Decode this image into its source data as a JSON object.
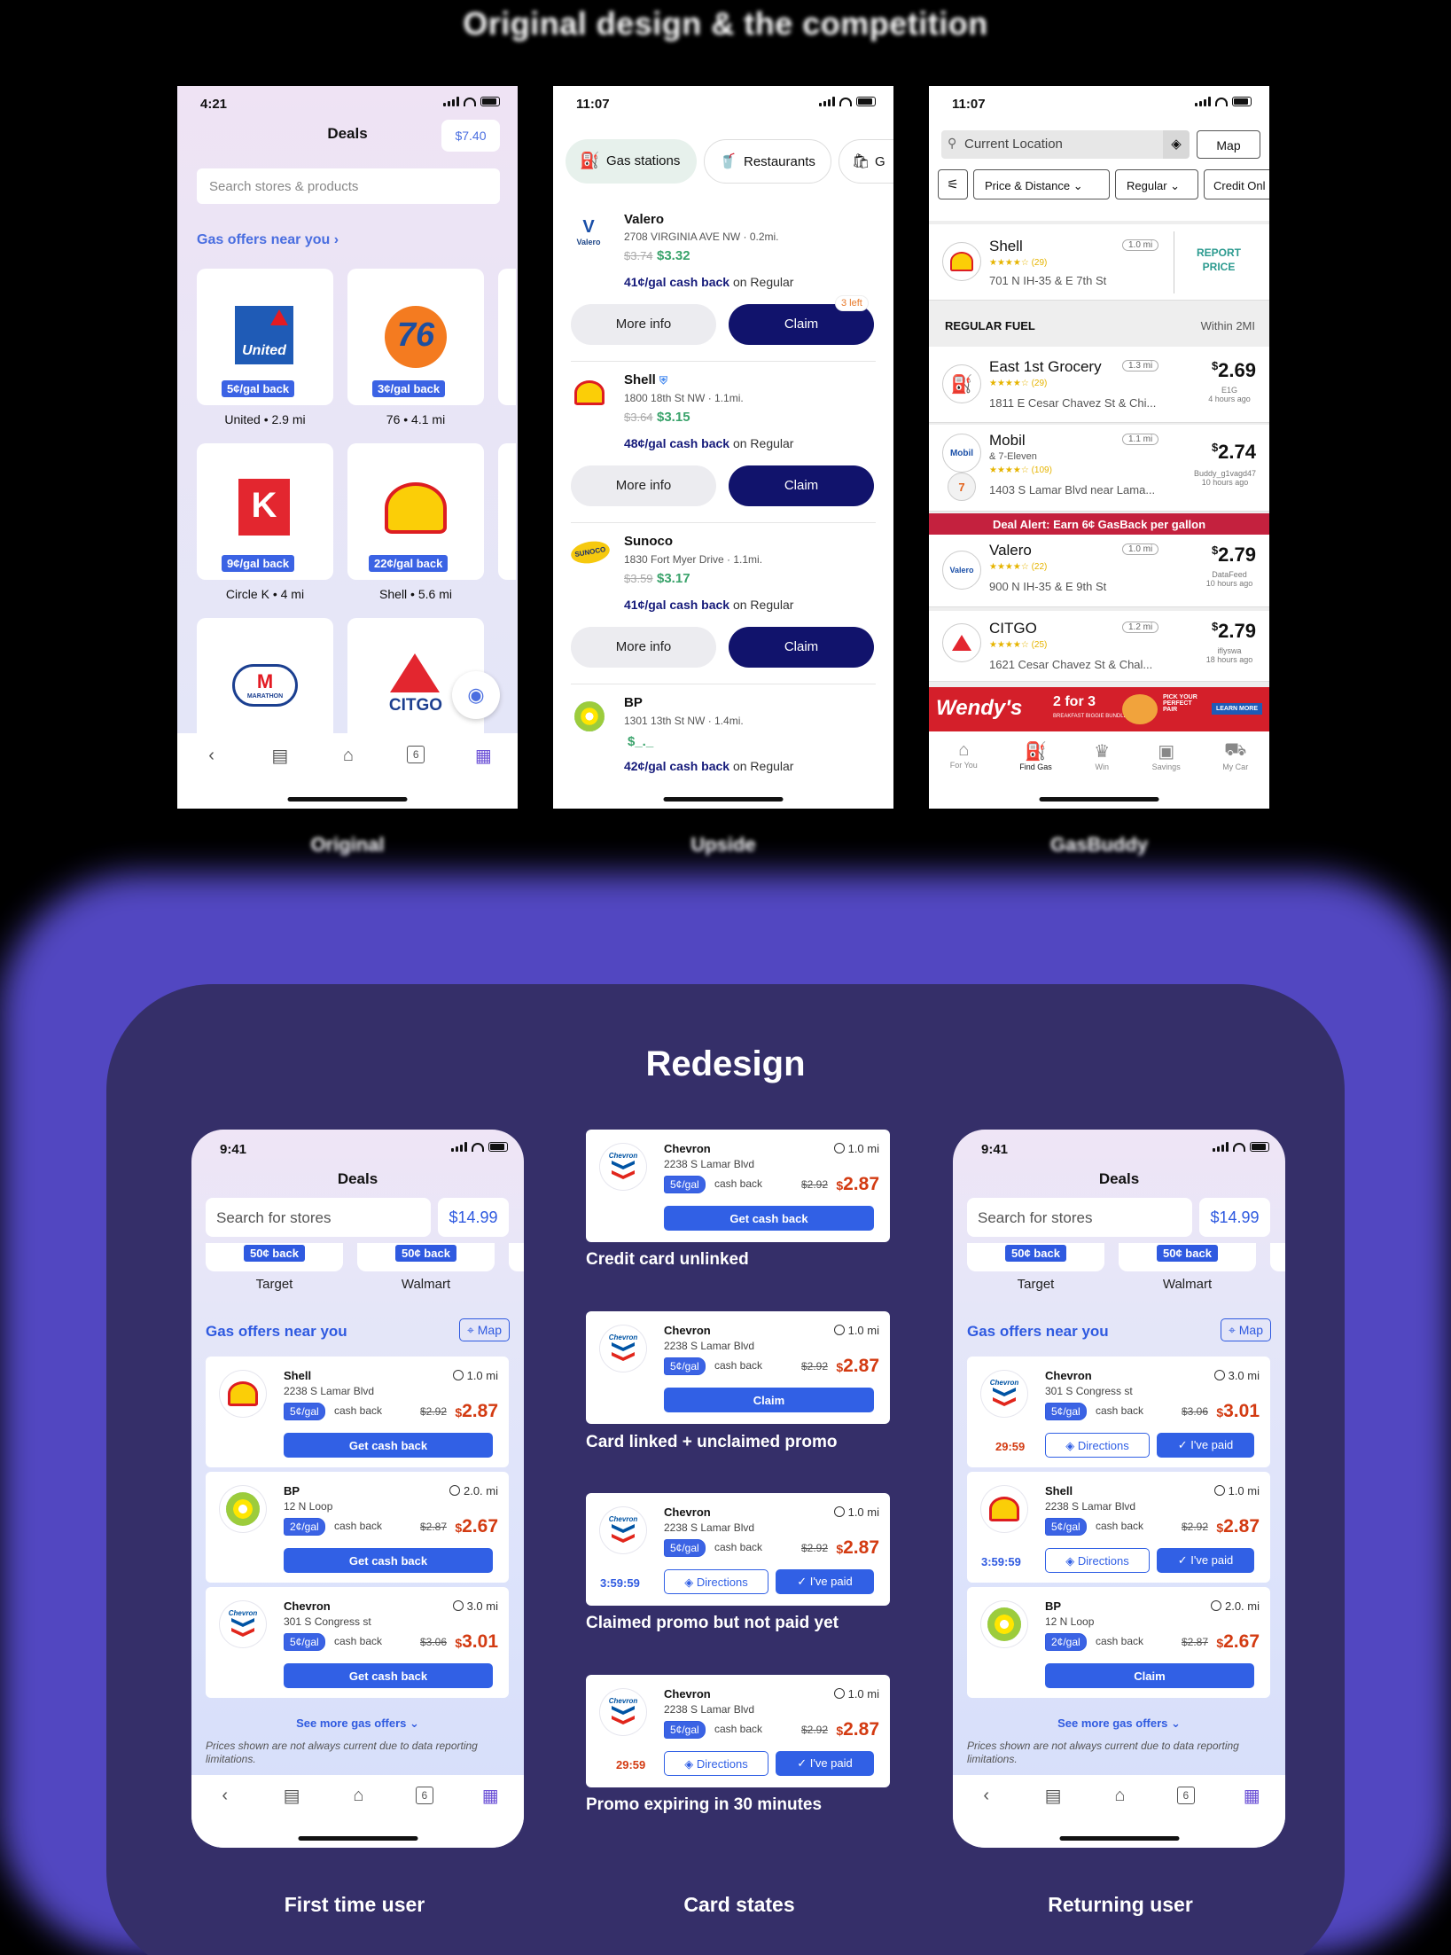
{
  "heading": "Original design & the competition",
  "original_captions": [
    "Original",
    "Upside",
    "GasBuddy"
  ],
  "ibotta": {
    "time": "4:21",
    "title": "Deals",
    "balance": "$7.40",
    "search_placeholder": "Search stores & products",
    "section": "Gas offers near you",
    "tiles": [
      {
        "logo": "United",
        "offer": "5¢/gal back",
        "label": "United • 2.9 mi"
      },
      {
        "logo": "76",
        "offer": "3¢/gal back",
        "label": "76 • 4.1 mi"
      },
      {
        "logo": "K",
        "offer": "9¢/gal back",
        "label": "Circle K • 4 mi"
      },
      {
        "logo": "Shell",
        "offer": "22¢/gal back",
        "label": "Shell • 5.6 mi"
      },
      {
        "logo": "MARATHON",
        "offer": "",
        "label": ""
      },
      {
        "logo": "CITGO",
        "offer": "",
        "label": ""
      }
    ],
    "tab_badge": "6"
  },
  "upside": {
    "time": "11:07",
    "chips": [
      "Gas stations",
      "Restaurants",
      "G"
    ],
    "stations": [
      {
        "name": "Valero",
        "addr": "2708 VIRGINIA AVE NW · 0.2mi.",
        "old": "$3.74",
        "price": "$3.32",
        "cash": "41¢/gal cash back",
        "on": "on Regular",
        "badge": "3 left"
      },
      {
        "name": "Shell",
        "addr": "1800 18th St NW · 1.1mi.",
        "old": "$3.64",
        "price": "$3.15",
        "cash": "48¢/gal cash back",
        "on": "on Regular",
        "badge": ""
      },
      {
        "name": "Sunoco",
        "addr": "1830 Fort Myer Drive · 1.1mi.",
        "old": "$3.59",
        "price": "$3.17",
        "cash": "41¢/gal cash back",
        "on": "on Regular",
        "badge": ""
      },
      {
        "name": "BP",
        "addr": "1301 13th St NW · 1.4mi.",
        "old": "",
        "price": "$_._",
        "cash": "42¢/gal cash back",
        "on": "on Regular",
        "badge": ""
      }
    ],
    "more_info": "More info",
    "claim": "Claim"
  },
  "gasbuddy": {
    "time": "11:07",
    "location": "Current Location",
    "map": "Map",
    "filters": [
      "Price & Distance",
      "Regular",
      "Credit Onl"
    ],
    "shell": {
      "name": "Shell",
      "stars": "★★★★☆ (29)",
      "addr": "701 N IH-35 & E 7th St",
      "dist": "1.0 mi",
      "report": "REPORT PRICE"
    },
    "section": "REGULAR FUEL",
    "section_right": "Within 2MI",
    "rows": [
      {
        "name": "East 1st Grocery",
        "stars": "★★★★☆ (29)",
        "addr": "1811 E Cesar Chavez St & Chi...",
        "dist": "1.3 mi",
        "price": "2.69",
        "sub1": "E1G",
        "sub2": "4 hours ago"
      },
      {
        "name": "Mobil",
        "extra": "& 7-Eleven",
        "stars": "★★★★☆ (109)",
        "addr": "1403 S Lamar Blvd near Lama...",
        "dist": "1.1 mi",
        "price": "2.74",
        "sub1": "Buddy_g1vagd47",
        "sub2": "10 hours ago"
      },
      {
        "name": "Valero",
        "stars": "★★★★☆ (22)",
        "addr": "900 N IH-35 & E 9th St",
        "dist": "1.0 mi",
        "price": "2.79",
        "sub1": "DataFeed",
        "sub2": "10 hours ago"
      },
      {
        "name": "CITGO",
        "stars": "★★★★☆ (25)",
        "addr": "1621 Cesar Chavez St & Chal...",
        "dist": "1.2 mi",
        "price": "2.79",
        "sub1": "iflyswa",
        "sub2": "18 hours ago"
      }
    ],
    "deal_alert": "Deal Alert: Earn 6¢ GasBack per gallon",
    "ad": "Wendy's",
    "ad_big": "2 for 3",
    "ad_tag": "PICK YOUR PERFECT PAIR",
    "ad_sub": "BREAKFAST BIGGIE BUNDLES",
    "ad_cta": "LEARN MORE",
    "tabs": [
      "For You",
      "Find Gas",
      "Win",
      "Savings",
      "My Car"
    ]
  },
  "redesign": {
    "title": "Redesign",
    "time": "9:41",
    "deals": "Deals",
    "search": "Search for stores",
    "balance": "$14.99",
    "stores": [
      {
        "offer": "50¢ back",
        "name": "Target"
      },
      {
        "offer": "50¢ back",
        "name": "Walmart"
      }
    ],
    "section": "Gas offers near you",
    "map": "Map",
    "more": "See more gas offers",
    "note": "Prices shown are not always current due to data reporting limitations.",
    "tab_badge": "6",
    "first_cards": [
      {
        "name": "Shell",
        "addr": "2238 S Lamar Blvd",
        "dist": "1.0 mi",
        "pill": "5¢/gal",
        "cb": "cash back",
        "old": "$2.92",
        "price": "2.87",
        "btn": "Get cash back"
      },
      {
        "name": "BP",
        "addr": "12 N Loop",
        "dist": "2.0. mi",
        "pill": "2¢/gal",
        "cb": "cash back",
        "old": "$2.87",
        "price": "2.67",
        "btn": "Get cash back"
      },
      {
        "name": "Chevron",
        "addr": "301 S Congress st",
        "dist": "3.0 mi",
        "pill": "5¢/gal",
        "cb": "cash back",
        "old": "$3.06",
        "price": "3.01",
        "btn": "Get cash back"
      }
    ],
    "state_cards": [
      {
        "name": "Chevron",
        "addr": "2238 S Lamar Blvd",
        "dist": "1.0 mi",
        "pill": "5¢/gal",
        "cb": "cash back",
        "old": "$2.92",
        "price": "2.87",
        "btn": "Get cash back",
        "caption": "Credit card unlinked"
      },
      {
        "name": "Chevron",
        "addr": "2238 S Lamar Blvd",
        "dist": "1.0 mi",
        "pill": "5¢/gal",
        "cb": "cash back",
        "old": "$2.92",
        "price": "2.87",
        "btn": "Claim",
        "caption": "Card linked + unclaimed promo"
      },
      {
        "name": "Chevron",
        "addr": "2238 S Lamar Blvd",
        "dist": "1.0 mi",
        "pill": "5¢/gal",
        "cb": "cash back",
        "old": "$2.92",
        "price": "2.87",
        "timer": "3:59:59",
        "dir": "Directions",
        "paid": "I've paid",
        "caption": "Claimed promo but not paid yet"
      },
      {
        "name": "Chevron",
        "addr": "2238 S Lamar Blvd",
        "dist": "1.0 mi",
        "pill": "5¢/gal",
        "cb": "cash back",
        "old": "$2.92",
        "price": "2.87",
        "timer": "29:59",
        "dir": "Directions",
        "paid": "I've paid",
        "caption": "Promo expiring in 30 minutes"
      }
    ],
    "return_cards": [
      {
        "name": "Chevron",
        "addr": "301 S Congress st",
        "dist": "3.0 mi",
        "pill": "5¢/gal",
        "cb": "cash back",
        "old": "$3.06",
        "price": "3.01",
        "timer": "29:59",
        "dir": "Directions",
        "paid": "I've paid"
      },
      {
        "name": "Shell",
        "addr": "2238 S Lamar Blvd",
        "dist": "1.0 mi",
        "pill": "5¢/gal",
        "cb": "cash back",
        "old": "$2.92",
        "price": "2.87",
        "timer": "3:59:59",
        "dir": "Directions",
        "paid": "I've paid"
      },
      {
        "name": "BP",
        "addr": "12 N Loop",
        "dist": "2.0. mi",
        "pill": "2¢/gal",
        "cb": "cash back",
        "old": "$2.87",
        "price": "2.67",
        "btn": "Claim"
      }
    ],
    "captions": [
      "First time user",
      "Card states",
      "Returning user"
    ]
  },
  "colors": {
    "accent": "#3160e5",
    "price": "#d33b12",
    "panel": "#352f69",
    "glow": "#5b4fd6",
    "navy": "#11136c"
  }
}
